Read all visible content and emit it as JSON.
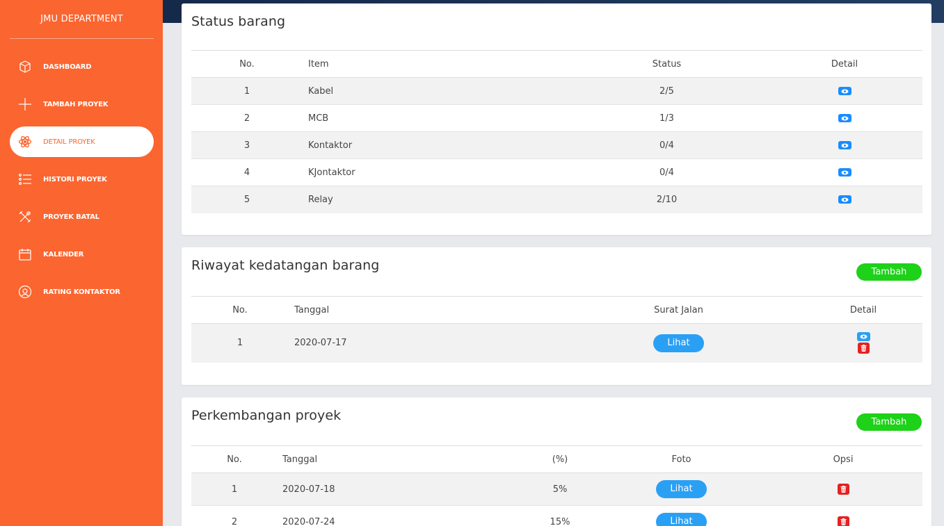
{
  "sidebar": {
    "brand": "JMU DEPARTMENT",
    "items": [
      {
        "label": "DASHBOARD",
        "icon": "box-icon"
      },
      {
        "label": "TAMBAH PROYEK",
        "icon": "plus-icon"
      },
      {
        "label": "DETAIL PROYEK",
        "icon": "atom-icon",
        "active": true
      },
      {
        "label": "HISTORI PROYEK",
        "icon": "list-icon"
      },
      {
        "label": "PROYEK BATAL",
        "icon": "tools-icon"
      },
      {
        "label": "KALENDER",
        "icon": "calendar-icon"
      },
      {
        "label": "RATING KONTAKTOR",
        "icon": "target-icon"
      }
    ]
  },
  "colors": {
    "sidebar": "#fb6530",
    "topbar": "#1b3152",
    "add_button": "#1ed119",
    "view_button": "#1a8cff",
    "lihat_button": "#2aa0f5",
    "delete_button": "#e52121"
  },
  "status_barang": {
    "title": "Status barang",
    "headers": [
      "No.",
      "Item",
      "Status",
      "Detail"
    ],
    "rows": [
      {
        "no": "1",
        "item": "Kabel",
        "status": "2/5"
      },
      {
        "no": "2",
        "item": "MCB",
        "status": "1/3"
      },
      {
        "no": "3",
        "item": "Kontaktor",
        "status": "0/4"
      },
      {
        "no": "4",
        "item": "KJontaktor",
        "status": "0/4"
      },
      {
        "no": "5",
        "item": "Relay",
        "status": "2/10"
      }
    ]
  },
  "riwayat": {
    "title": "Riwayat kedatangan barang",
    "add_label": "Tambah",
    "headers": [
      "No.",
      "Tanggal",
      "Surat Jalan",
      "Detail"
    ],
    "rows": [
      {
        "no": "1",
        "tanggal": "2020-07-17",
        "surat_jalan": "Lihat"
      }
    ]
  },
  "perkembangan": {
    "title": "Perkembangan proyek",
    "add_label": "Tambah",
    "headers": [
      "No.",
      "Tanggal",
      "(%)",
      "Foto",
      "Opsi"
    ],
    "rows": [
      {
        "no": "1",
        "tanggal": "2020-07-18",
        "persen": "5%",
        "foto": "Lihat"
      },
      {
        "no": "2",
        "tanggal": "2020-07-24",
        "persen": "15%",
        "foto": "Lihat"
      }
    ]
  }
}
